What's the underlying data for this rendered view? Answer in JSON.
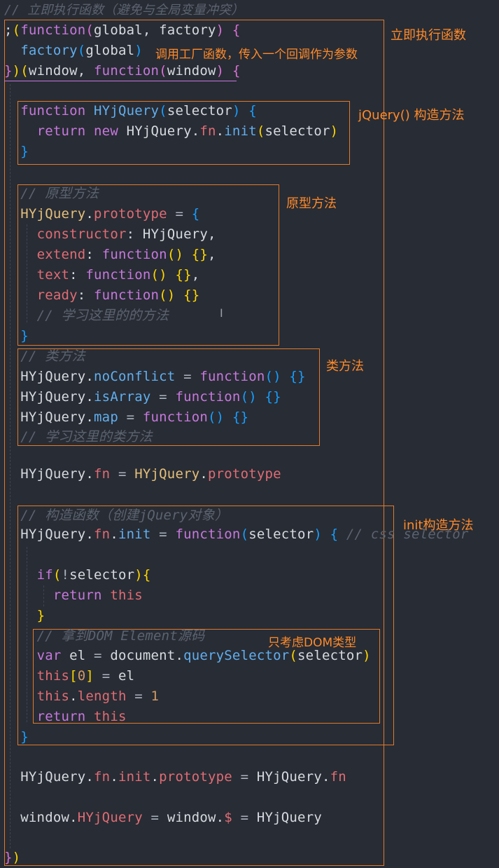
{
  "code": {
    "comment_iife": "// 立即执行函数（避免与全局变量冲突）",
    "iife_open_kw": "function",
    "iife_open_args": "global, factory",
    "factory_call": "factory",
    "factory_arg": "global",
    "iife_close_prefix": "})(",
    "iife_close_window": "window",
    "iife_close_kw": "function",
    "iife_close_param": "window",
    "ctor_kw": "function",
    "ctor_name": "HYjQuery",
    "ctor_param": "selector",
    "return_kw": "return",
    "new_kw": "new",
    "ctor_return_cls": "HYjQuery",
    "fn_prop": "fn",
    "init_method": "init",
    "ctor_return_arg": "selector",
    "comment_proto": "// 原型方法",
    "proto_cls": "HYjQuery",
    "proto_prop": "prototype",
    "k_constructor": "constructor",
    "v_constructor": "HYjQuery",
    "k_extend": "extend",
    "k_text": "text",
    "k_ready": "ready",
    "comment_learn_proto": "// 学习这里的的方法",
    "comment_static": "// 类方法",
    "m_noconflict": "noConflict",
    "m_isarray": "isArray",
    "m_map": "map",
    "comment_learn_static": "// 学习这里的类方法",
    "assign_fn_cls": "HYjQuery",
    "assign_fn_prop": "fn",
    "assign_fn_rhs_cls": "HYjQuery",
    "assign_fn_rhs_prop": "prototype",
    "comment_init": "// 构造函数（创建jQuery对象）",
    "init_cls": "HYjQuery",
    "init_fn": "fn",
    "init_name": "init",
    "init_kw": "function",
    "init_param": "selector",
    "init_trailing_comment": "// css selector",
    "if_kw": "if",
    "if_cond": "selector",
    "return_this_kw": "return",
    "this_kw": "this",
    "comment_dom": "// 拿到DOM Element源码",
    "var_kw": "var",
    "var_name": "el",
    "document_obj": "document",
    "qs_method": "querySelector",
    "qs_arg": "selector",
    "this_index_kw": "this",
    "index_num": "0",
    "el_ref": "el",
    "this_len_kw": "this",
    "length_prop": "length",
    "length_val": "1",
    "final_return": "return",
    "final_this": "this",
    "proto_chain_cls": "HYjQuery",
    "proto_chain_fn": "fn",
    "proto_chain_init": "init",
    "proto_chain_proto": "prototype",
    "proto_chain_rhs_cls": "HYjQuery",
    "proto_chain_rhs_fn": "fn",
    "window_obj": "window",
    "window_prop": "HYjQuery",
    "window_obj2": "window",
    "dollar": "$",
    "window_rhs": "HYjQuery",
    "closing": "})"
  },
  "annotations": {
    "iife": "立即执行函数",
    "factory": "调用工厂函数，传入一个回调作为参数",
    "jquery_ctor": "jQuery() 构造方法",
    "proto": "原型方法",
    "static": "类方法",
    "init": "init构造方法",
    "dom_only": "只考虑DOM类型"
  },
  "colors": {
    "background": "#282c34",
    "annotation": "#ff8a2a",
    "box_border": "#e07a2b"
  }
}
